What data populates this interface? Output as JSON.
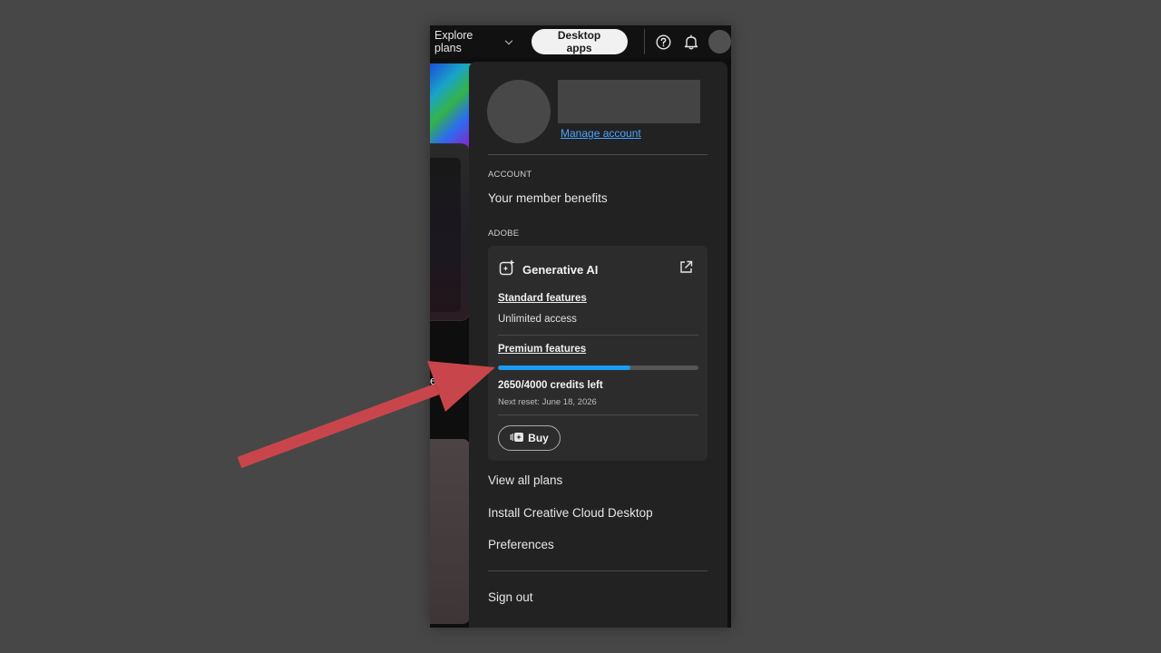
{
  "topnav": {
    "explore_label": "Explore plans",
    "desktop_apps_label": "Desktop apps",
    "help_icon": "help-circle-icon",
    "bell_icon": "bell-icon"
  },
  "background": {
    "partial_text": "esi"
  },
  "profile": {
    "manage_account_label": "Manage account"
  },
  "account_section": {
    "label": "ACCOUNT",
    "items": [
      "Your member benefits"
    ]
  },
  "adobe_section": {
    "label": "ADOBE"
  },
  "genai": {
    "title": "Generative AI",
    "icon": "generative-ai-icon",
    "standard_label": "Standard features",
    "standard_value": "Unlimited access",
    "premium_label": "Premium features",
    "progress_fraction": 0.6625,
    "credits_text": "2650/4000 credits left",
    "reset_text": "Next reset: June 18, 2026",
    "buy_label": "Buy"
  },
  "menu": {
    "view_plans": "View all plans",
    "install_ccd": "Install Creative Cloud Desktop",
    "preferences": "Preferences",
    "sign_out": "Sign out"
  },
  "colors": {
    "accent_blue": "#1b9cf0",
    "link_blue": "#4aa3ff",
    "arrow_red": "#c8464b",
    "panel_bg": "#222222"
  }
}
